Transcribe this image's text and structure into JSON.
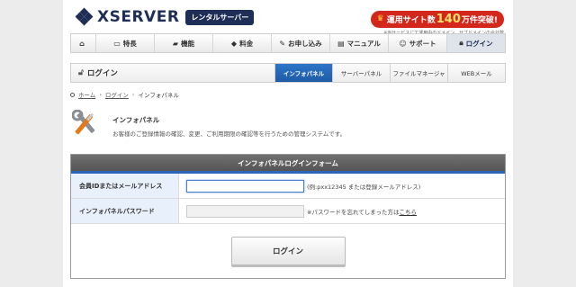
{
  "header": {
    "brand": "XSERVER",
    "brand_badge": "レンタルサーバー",
    "promo_prefix": "運用サイト数",
    "promo_number": "140",
    "promo_suffix": "万件突破!",
    "promo_note": "※当サービスにて運用中のドメイン、サブドメインの合計数"
  },
  "nav": {
    "items": [
      {
        "label": "",
        "icon": "home-icon"
      },
      {
        "label": "特長",
        "icon": "monitor-icon"
      },
      {
        "label": "機能",
        "icon": "folder-icon"
      },
      {
        "label": "料金",
        "icon": "tag-icon"
      },
      {
        "label": "お申し込み",
        "icon": "pencil-icon"
      },
      {
        "label": "マニュアル",
        "icon": "book-icon"
      },
      {
        "label": "サポート",
        "icon": "people-icon"
      },
      {
        "label": "ログイン",
        "icon": "lock-icon"
      }
    ]
  },
  "subheader": {
    "title": "ログイン",
    "tabs": [
      "インフォパネル",
      "サーバーパネル",
      "ファイルマネージャ",
      "WEBメール"
    ]
  },
  "breadcrumb": {
    "home": "ホーム",
    "mid": "ログイン",
    "current": "インフォパネル"
  },
  "intro": {
    "title": "インフォパネル",
    "desc": "お客様のご登録情報の確認、変更、ご利用期限の確認等を行うための管理システムです。"
  },
  "form": {
    "heading": "インフォパネルログインフォーム",
    "id_label": "会員IDまたはメールアドレス",
    "id_value": "",
    "id_hint": "(例:pxx12345 または登録メールアドレス)",
    "pw_label": "インフォパネルパスワード",
    "pw_value": "",
    "pw_hint": "※パスワードを忘れてしまった方は",
    "pw_link": "こちら",
    "submit": "ログイン"
  },
  "colors": {
    "brand": "#1e2e57",
    "accent_blue": "#2c66b8",
    "promo_red": "#d3271c"
  }
}
